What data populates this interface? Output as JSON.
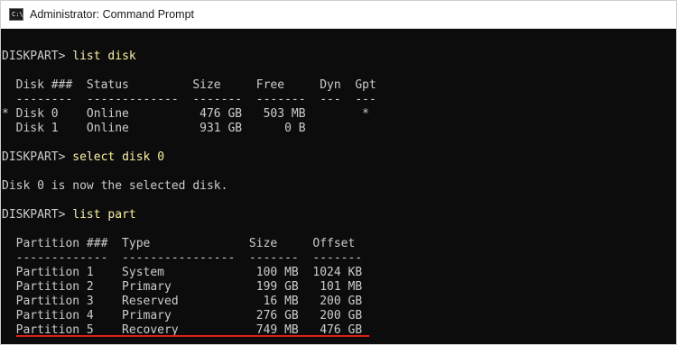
{
  "window": {
    "title": "Administrator: Command Prompt",
    "icon_text": "C:\\."
  },
  "console": {
    "lines": [
      {
        "kind": "blank",
        "prompt": "",
        "command": "",
        "text": ""
      },
      {
        "kind": "cmd",
        "prompt": "DISKPART> ",
        "command": "list disk",
        "text": ""
      },
      {
        "kind": "blank",
        "prompt": "",
        "command": "",
        "text": ""
      },
      {
        "kind": "text",
        "prompt": "",
        "command": "",
        "text": "  Disk ###  Status         Size     Free     Dyn  Gpt"
      },
      {
        "kind": "text",
        "prompt": "",
        "command": "",
        "text": "  --------  -------------  -------  -------  ---  ---"
      },
      {
        "kind": "text",
        "prompt": "",
        "command": "",
        "text": "* Disk 0    Online          476 GB   503 MB        *"
      },
      {
        "kind": "text",
        "prompt": "",
        "command": "",
        "text": "  Disk 1    Online          931 GB      0 B"
      },
      {
        "kind": "blank",
        "prompt": "",
        "command": "",
        "text": ""
      },
      {
        "kind": "cmd",
        "prompt": "DISKPART> ",
        "command": "select disk 0",
        "text": ""
      },
      {
        "kind": "blank",
        "prompt": "",
        "command": "",
        "text": ""
      },
      {
        "kind": "text",
        "prompt": "",
        "command": "",
        "text": "Disk 0 is now the selected disk."
      },
      {
        "kind": "blank",
        "prompt": "",
        "command": "",
        "text": ""
      },
      {
        "kind": "cmd",
        "prompt": "DISKPART> ",
        "command": "list part",
        "text": ""
      },
      {
        "kind": "blank",
        "prompt": "",
        "command": "",
        "text": ""
      },
      {
        "kind": "text",
        "prompt": "",
        "command": "",
        "text": "  Partition ###  Type              Size     Offset"
      },
      {
        "kind": "text",
        "prompt": "",
        "command": "",
        "text": "  -------------  ----------------  -------  -------"
      },
      {
        "kind": "text",
        "prompt": "",
        "command": "",
        "text": "  Partition 1    System             100 MB  1024 KB"
      },
      {
        "kind": "text",
        "prompt": "",
        "command": "",
        "text": "  Partition 2    Primary            199 GB   101 MB"
      },
      {
        "kind": "text",
        "prompt": "",
        "command": "",
        "text": "  Partition 3    Reserved            16 MB   200 GB"
      },
      {
        "kind": "text",
        "prompt": "",
        "command": "",
        "text": "  Partition 4    Primary            276 GB   200 GB"
      },
      {
        "kind": "text",
        "prompt": "",
        "command": "",
        "text": "  Partition 5    Recovery           749 MB   476 GB"
      }
    ]
  },
  "colors": {
    "background": "#0c0c0c",
    "text": "#cccccc",
    "command": "#f9f1a5",
    "highlight_underline": "#e0201a"
  }
}
